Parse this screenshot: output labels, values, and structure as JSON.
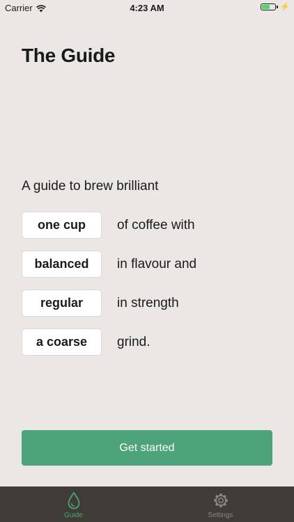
{
  "status_bar": {
    "carrier": "Carrier",
    "time": "4:23 AM",
    "battery_level": 0.6,
    "battery_color": "#4cd964"
  },
  "header": {
    "title": "The Guide"
  },
  "guide": {
    "intro": "A guide to brew brilliant",
    "rows": [
      {
        "choice": "one cup",
        "text": "of coffee with"
      },
      {
        "choice": "balanced",
        "text": "in flavour and"
      },
      {
        "choice": "regular",
        "text": "in strength"
      },
      {
        "choice": "a coarse",
        "text": "grind."
      }
    ]
  },
  "actions": {
    "get_started_label": "Get started",
    "accent_color": "#4da47b"
  },
  "tab_bar": {
    "items": [
      {
        "label": "Guide",
        "icon": "drop-icon",
        "active": true,
        "color": "#4da47b"
      },
      {
        "label": "Settings",
        "icon": "gear-icon",
        "active": false,
        "color": "#8a8580"
      }
    ]
  }
}
